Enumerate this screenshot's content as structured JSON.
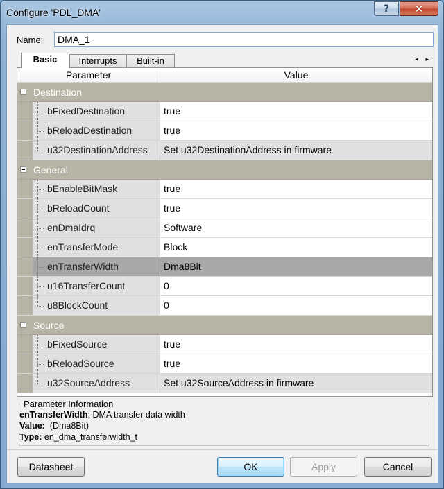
{
  "window": {
    "title": "Configure 'PDL_DMA'",
    "help_label": "?",
    "close_label": "✕"
  },
  "name_field": {
    "label": "Name:",
    "value": "DMA_1"
  },
  "tabs": [
    {
      "label": "Basic"
    },
    {
      "label": "Interrupts"
    },
    {
      "label": "Built-in"
    }
  ],
  "tab_scroll_label": "◂ ▸",
  "grid": {
    "col_param": "Parameter",
    "col_value": "Value",
    "categories": [
      {
        "label": "Destination",
        "rows": [
          {
            "name": "bFixedDestination",
            "value": "true"
          },
          {
            "name": "bReloadDestination",
            "value": "true"
          },
          {
            "name": "u32DestinationAddress",
            "value": "Set u32DestinationAddress in firmware"
          }
        ]
      },
      {
        "label": "General",
        "rows": [
          {
            "name": "bEnableBitMask",
            "value": "true"
          },
          {
            "name": "bReloadCount",
            "value": "true"
          },
          {
            "name": "enDmaIdrq",
            "value": "Software"
          },
          {
            "name": "enTransferMode",
            "value": "Block"
          },
          {
            "name": "enTransferWidth",
            "value": "Dma8Bit"
          },
          {
            "name": "u16TransferCount",
            "value": "0"
          },
          {
            "name": "u8BlockCount",
            "value": "0"
          }
        ]
      },
      {
        "label": "Source",
        "rows": [
          {
            "name": "bFixedSource",
            "value": "true"
          },
          {
            "name": "bReloadSource",
            "value": "true"
          },
          {
            "name": "u32SourceAddress",
            "value": "Set u32SourceAddress in firmware"
          }
        ]
      }
    ]
  },
  "info": {
    "title": "Parameter Information",
    "param_name": "enTransferWidth",
    "param_desc": ": DMA transfer data width",
    "value_label": "Value:",
    "value_text": "(Dma8Bit)",
    "type_label": "Type:",
    "type_text": "en_dma_transferwidth_t"
  },
  "buttons": {
    "datasheet": "Datasheet",
    "ok": "OK",
    "apply": "Apply",
    "cancel": "Cancel"
  }
}
